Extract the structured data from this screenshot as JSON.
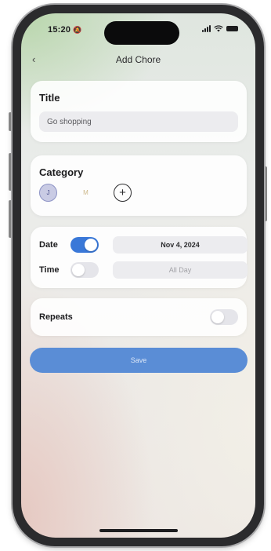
{
  "status_bar": {
    "time": "15:20",
    "bell_glyph": "🔕",
    "icons": [
      "bell-slash-icon",
      "signal-icon",
      "wifi-icon",
      "battery-icon"
    ]
  },
  "nav": {
    "back_glyph": "‹",
    "title": "Add Chore"
  },
  "title_card": {
    "heading": "Title",
    "input_value": "Go shopping"
  },
  "category_card": {
    "heading": "Category",
    "chips": [
      {
        "label": "J",
        "selected": true
      },
      {
        "label": "M",
        "selected": false
      }
    ],
    "add_glyph": "+"
  },
  "schedule_card": {
    "date_label": "Date",
    "date_enabled": true,
    "date_value": "Nov 4, 2024",
    "time_label": "Time",
    "time_enabled": false,
    "time_value": "All Day"
  },
  "repeats_card": {
    "label": "Repeats",
    "enabled": false
  },
  "save_button": {
    "label": "Save"
  },
  "colors": {
    "accent": "#3a78d8",
    "save_button": "#5a8dd6",
    "selected_chip": "#c9cbe4"
  }
}
